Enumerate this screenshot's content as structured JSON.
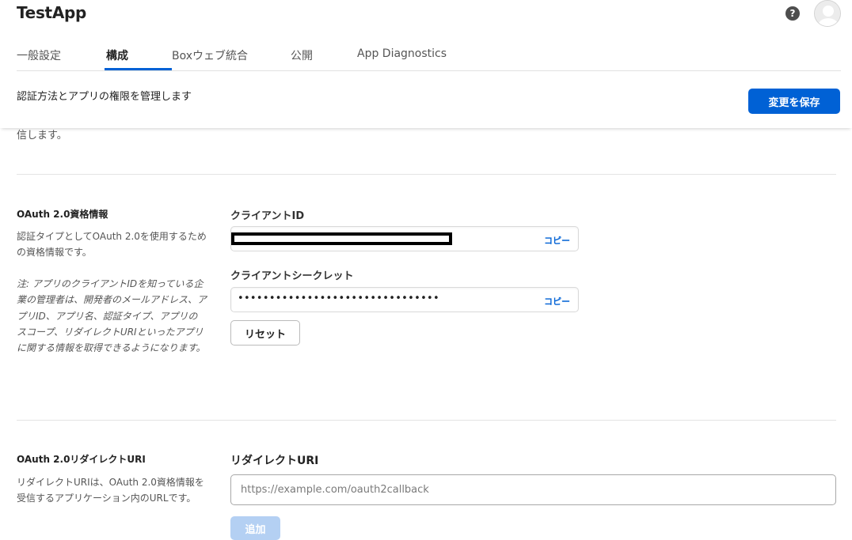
{
  "app": {
    "title": "TestApp"
  },
  "header": {
    "help_icon": "question-circle-icon",
    "help_glyph": "?",
    "avatar_icon": "user-avatar-icon"
  },
  "tabs": [
    {
      "label": "一般設定",
      "active": false
    },
    {
      "label": "構成",
      "active": true
    },
    {
      "label": "Boxウェブ統合",
      "active": false
    },
    {
      "label": "公開",
      "active": false
    },
    {
      "label": "App Diagnostics",
      "active": false
    }
  ],
  "sticky": {
    "description": "認証方法とアプリの権限を管理します",
    "save_label": "変更を保存"
  },
  "scroll_fragment": "信します。",
  "oauth_credentials": {
    "title": "OAuth 2.0資格情報",
    "description": "認証タイプとしてOAuth 2.0を使用するための資格情報です。",
    "note": "注: アプリのクライアントIDを知っている企業の管理者は、開発者のメールアドレス、アプリID、アプリ名、認証タイプ、アプリのスコープ、リダイレクトURIといったアプリに関する情報を取得できるようになります。",
    "client_id_label": "クライアントID",
    "client_id_copy": "コピー",
    "client_secret_label": "クライアントシークレット",
    "client_secret_value": "••••••••••••••••••••••••••••••••",
    "client_secret_copy": "コピー",
    "reset_label": "リセット"
  },
  "redirect": {
    "title": "OAuth 2.0リダイレクトURI",
    "description": "リダイレクトURIは、OAuth 2.0資格情報を受信するアプリケーション内のURLです。",
    "field_label": "リダイレクトURI",
    "placeholder": "https://example.com/oauth2callback",
    "add_label": "追加"
  },
  "colors": {
    "accent": "#0061d5",
    "disabled_button": "#b4d0f3",
    "help_icon_bg": "#4e4e4e"
  }
}
